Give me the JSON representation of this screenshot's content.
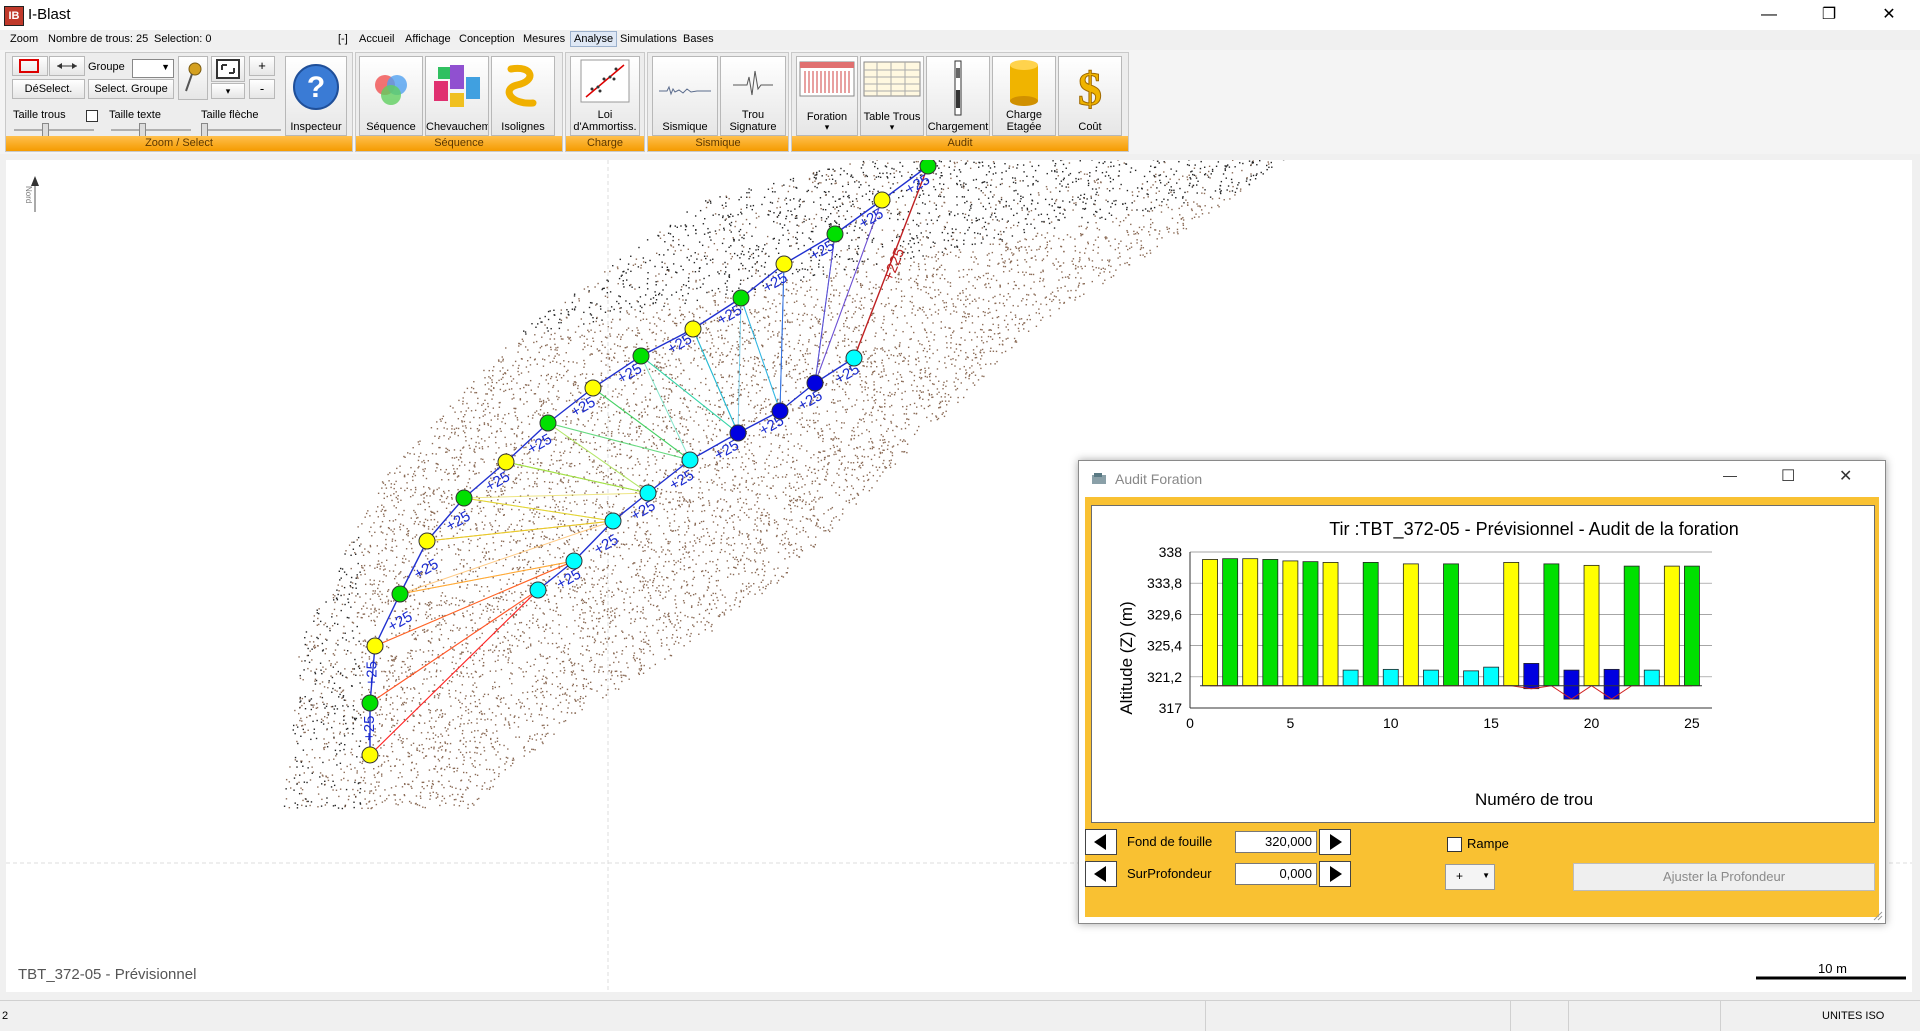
{
  "window": {
    "title": "I-Blast",
    "logo_text": "IB",
    "controls": {
      "minimize": "—",
      "maximize": "❐",
      "close": "✕"
    }
  },
  "menu": {
    "zoom": "Zoom",
    "nb_trous": "Nombre de trous: 25",
    "selection": "Selection: 0",
    "collapse": "[-]",
    "tabs": [
      "Accueil",
      "Affichage",
      "Conception",
      "Mesures",
      "Analyse",
      "Simulations",
      "Bases"
    ]
  },
  "ribbon": {
    "zoom_select": {
      "footer": "Zoom / Select",
      "deselect": "DéSelect.",
      "groupe_label": "Groupe",
      "select_groupe": "Select. Groupe",
      "plus": "+",
      "minus": "-",
      "inspecteur": "Inspecteur",
      "taille_trous": "Taille trous",
      "taille_texte": "Taille texte",
      "taille_fleche": "Taille flèche"
    },
    "sequence": {
      "footer": "Séquence",
      "sequence": "Séquence",
      "chevauchement": "Chevaucheme",
      "isolignes": "Isolignes"
    },
    "charge": {
      "footer": "Charge",
      "loi": "Loi",
      "loi2": "d'Ammortiss."
    },
    "sismique": {
      "footer": "Sismique",
      "sismique": "Sismique",
      "trou": "Trou",
      "signature": "Signature"
    },
    "audit": {
      "footer": "Audit",
      "foration": "Foration",
      "table_trous": "Table Trous",
      "chargement": "Chargement",
      "charge": "Charge",
      "etagee": "Etagée",
      "cout": "Coût"
    }
  },
  "canvas": {
    "north_label": "Nord",
    "view_label": "TBT_372-05 - Prévisionnel",
    "scale_label": "10 m",
    "delay_label": "+25",
    "long_delay_label": "+225"
  },
  "status": {
    "left": "2",
    "units": "UNITES ISO"
  },
  "dialog": {
    "title": "Audit Foration",
    "controls": {
      "minimize": "—",
      "maximize": "☐",
      "close": "✕"
    },
    "fond_label": "Fond de fouille",
    "fond_value": "320,000",
    "sur_label": "SurProfondeur",
    "sur_value": "0,000",
    "rampe_label": "Rampe",
    "combo_value": "+",
    "ajuster": "Ajuster la Profondeur"
  },
  "colors": {
    "yellow": "#ffff00",
    "green": "#00e000",
    "cyan": "#00ffff",
    "blue": "#0000e0",
    "ribbon_footer": "#f59b00",
    "dialog_bg": "#f9c132"
  },
  "chart_data": {
    "type": "bar",
    "title": "Tir :TBT_372-05 - Prévisionnel - Audit de la foration",
    "xlabel": "Numéro de trou",
    "ylabel": "Altitude (Z) (m)",
    "ylim": [
      317,
      338
    ],
    "yticks": [
      "338",
      "333,8",
      "329,6",
      "325,4",
      "321,2",
      "317"
    ],
    "xticks": [
      0,
      5,
      10,
      15,
      20,
      25
    ],
    "xlim": [
      0,
      26
    ],
    "baseline": 320,
    "bars": [
      {
        "x": 1,
        "top": 337,
        "bottom": 320,
        "color": "yellow"
      },
      {
        "x": 2,
        "top": 337.1,
        "bottom": 320,
        "color": "green"
      },
      {
        "x": 3,
        "top": 337.1,
        "bottom": 320,
        "color": "yellow"
      },
      {
        "x": 4,
        "top": 337,
        "bottom": 320,
        "color": "green"
      },
      {
        "x": 5,
        "top": 336.8,
        "bottom": 320,
        "color": "yellow"
      },
      {
        "x": 6,
        "top": 336.7,
        "bottom": 320,
        "color": "green"
      },
      {
        "x": 7,
        "top": 336.6,
        "bottom": 320,
        "color": "yellow"
      },
      {
        "x": 8,
        "top": 322.1,
        "bottom": 320,
        "color": "cyan"
      },
      {
        "x": 9,
        "top": 336.6,
        "bottom": 320,
        "color": "green"
      },
      {
        "x": 10,
        "top": 322.2,
        "bottom": 320,
        "color": "cyan"
      },
      {
        "x": 11,
        "top": 336.4,
        "bottom": 320,
        "color": "yellow"
      },
      {
        "x": 12,
        "top": 322.1,
        "bottom": 320,
        "color": "cyan"
      },
      {
        "x": 13,
        "top": 336.4,
        "bottom": 320,
        "color": "green"
      },
      {
        "x": 14,
        "top": 322,
        "bottom": 320,
        "color": "cyan"
      },
      {
        "x": 15,
        "top": 322.5,
        "bottom": 320,
        "color": "cyan"
      },
      {
        "x": 16,
        "top": 336.6,
        "bottom": 320,
        "color": "yellow"
      },
      {
        "x": 17,
        "top": 323,
        "bottom": 319.6,
        "color": "blue"
      },
      {
        "x": 18,
        "top": 336.4,
        "bottom": 320,
        "color": "green"
      },
      {
        "x": 19,
        "top": 322.1,
        "bottom": 318.2,
        "color": "blue"
      },
      {
        "x": 20,
        "top": 336.2,
        "bottom": 320,
        "color": "yellow"
      },
      {
        "x": 21,
        "top": 322.2,
        "bottom": 318.2,
        "color": "blue"
      },
      {
        "x": 22,
        "top": 336.1,
        "bottom": 320,
        "color": "green"
      },
      {
        "x": 23,
        "top": 322.1,
        "bottom": 320,
        "color": "cyan"
      },
      {
        "x": 24,
        "top": 336.1,
        "bottom": 320,
        "color": "yellow"
      },
      {
        "x": 25,
        "top": 336.1,
        "bottom": 320,
        "color": "green"
      }
    ]
  }
}
